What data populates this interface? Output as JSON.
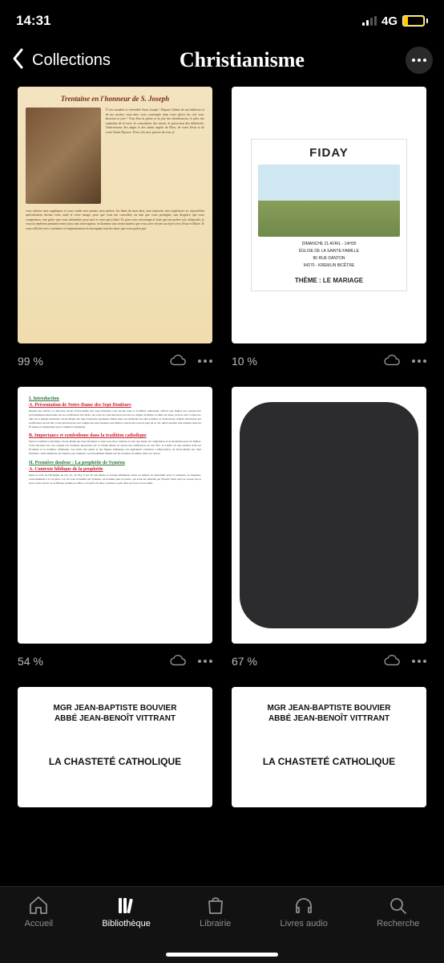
{
  "status": {
    "time": "14:31",
    "network_label": "4G",
    "battery_pct": "27"
  },
  "header": {
    "back_label": "Collections",
    "title": "Christianisme"
  },
  "books": [
    {
      "progress": "99 %",
      "cover_title": "Trentaine en l'honneur de S. Joseph"
    },
    {
      "progress": "10 %",
      "cover_title": "FIDAY",
      "cover_subtitle_line1": "DIMANCHE 21 AVRIL - 14H30",
      "cover_subtitle_line2": "ÉGLISE DE LA SAINTE FAMILLE",
      "cover_subtitle_line3": "86 RUE DANTON",
      "cover_subtitle_line4": "94270 - KREMLIN BICÊTRE",
      "cover_theme": "THÈME : LE MARIAGE"
    },
    {
      "progress": "54 %",
      "cover_h1": "I. Introduction",
      "cover_h1a": "A. Présentation de Notre-Dame des Sept Douleurs",
      "cover_h2": "B. Importance et symbolisme dans la tradition catholique",
      "cover_h3": "II. Première douleur : La prophétie de Syméon",
      "cover_h3a": "A. Contexte biblique de la prophétie"
    },
    {
      "progress": "67 %"
    },
    {
      "cover_author_line1": "MGR JEAN-BAPTISTE BOUVIER",
      "cover_author_line2": "ABBÉ JEAN-BENOÎT VITTRANT",
      "cover_title": "LA CHASTETÉ CATHOLIQUE"
    },
    {
      "cover_author_line1": "MGR JEAN-BAPTISTE BOUVIER",
      "cover_author_line2": "ABBÉ JEAN-BENOÎT VITTRANT",
      "cover_title": "LA CHASTETÉ CATHOLIQUE"
    }
  ],
  "tabs": {
    "home": "Accueil",
    "library": "Bibliothèque",
    "store": "Librairie",
    "audio": "Livres audio",
    "search": "Recherche"
  }
}
